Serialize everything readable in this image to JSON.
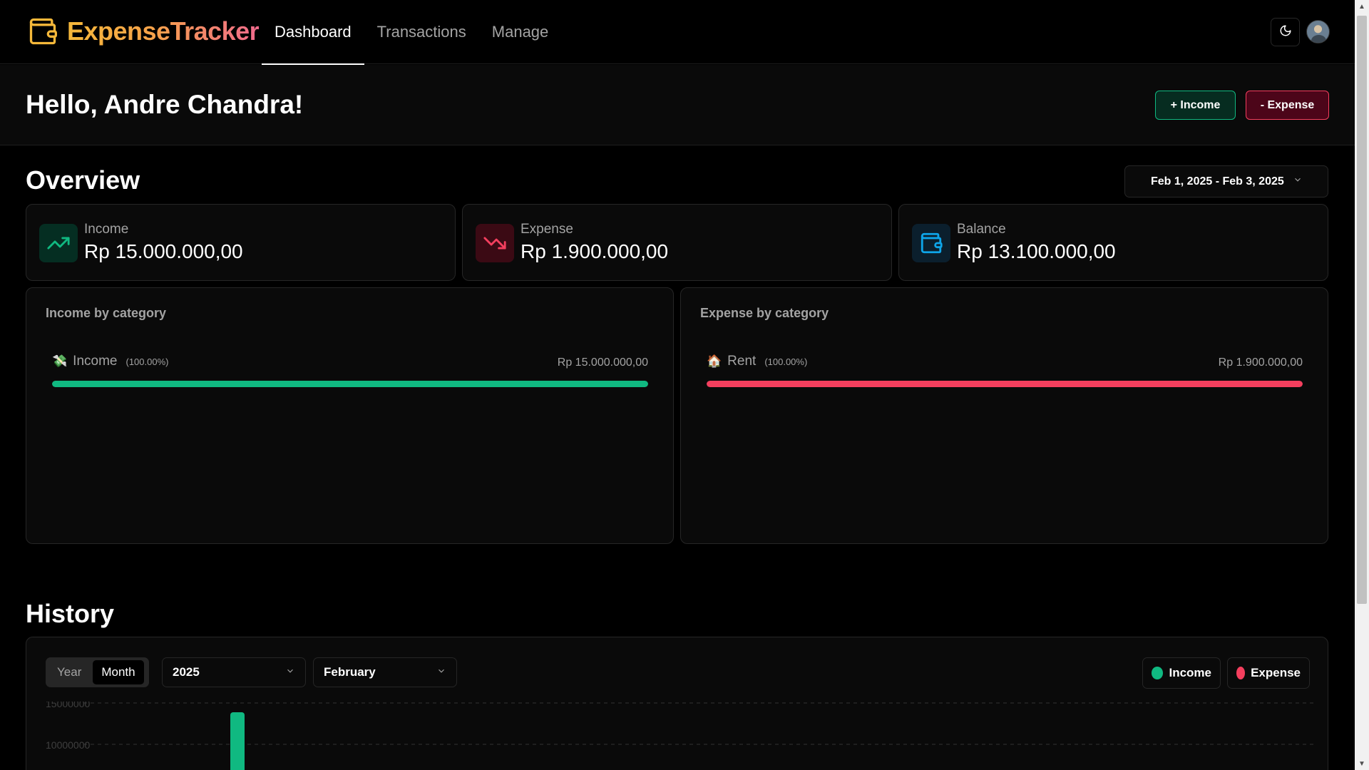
{
  "brand": {
    "name": "ExpenseTracker",
    "icon": "wallet-icon",
    "accent_start": "#f5b83a",
    "accent_end": "#f06a8c"
  },
  "nav": {
    "links": [
      {
        "label": "Dashboard",
        "active": true
      },
      {
        "label": "Transactions",
        "active": false
      },
      {
        "label": "Manage",
        "active": false
      }
    ],
    "theme_icon": "moon-icon"
  },
  "greeting": {
    "text": "Hello, Andre Chandra!"
  },
  "actions": {
    "income_label": "+ Income",
    "expense_label": "- Expense"
  },
  "overview": {
    "title": "Overview",
    "date_range": "Feb 1, 2025 - Feb 3, 2025",
    "stats": {
      "income": {
        "label": "Income",
        "value": "Rp 15.000.000,00",
        "icon": "trending-up-icon",
        "color": "#10b981"
      },
      "expense": {
        "label": "Expense",
        "value": "Rp 1.900.000,00",
        "icon": "trending-down-icon",
        "color": "#f43f5e"
      },
      "balance": {
        "label": "Balance",
        "value": "Rp 13.100.000,00",
        "icon": "wallet-icon",
        "color": "#0ea5e9"
      }
    },
    "income_by_category": {
      "title": "Income by category",
      "items": [
        {
          "emoji": "💸",
          "name": "Income",
          "percent": "(100.00%)",
          "amount": "Rp 15.000.000,00",
          "fraction": 1.0,
          "color": "#10b981"
        }
      ]
    },
    "expense_by_category": {
      "title": "Expense by category",
      "items": [
        {
          "emoji": "🏠",
          "name": "Rent",
          "percent": "(100.00%)",
          "amount": "Rp 1.900.000,00",
          "fraction": 1.0,
          "color": "#f43f5e"
        }
      ]
    }
  },
  "history": {
    "title": "History",
    "timeframe_tabs": [
      {
        "label": "Year",
        "active": false
      },
      {
        "label": "Month",
        "active": true
      }
    ],
    "year": "2025",
    "month": "February",
    "legend": [
      {
        "label": "Income",
        "color": "#10b981"
      },
      {
        "label": "Expense",
        "color": "#f43f5e"
      }
    ]
  },
  "chart_data": {
    "type": "bar",
    "title": "",
    "xlabel": "",
    "ylabel": "",
    "grid": true,
    "y_ticks": [
      "15000000",
      "10000000"
    ],
    "series": [
      {
        "name": "Income",
        "color": "#10b981",
        "points": [
          {
            "x": 1,
            "y": 15000000
          }
        ]
      },
      {
        "name": "Expense",
        "color": "#f43f5e",
        "points": []
      }
    ]
  }
}
